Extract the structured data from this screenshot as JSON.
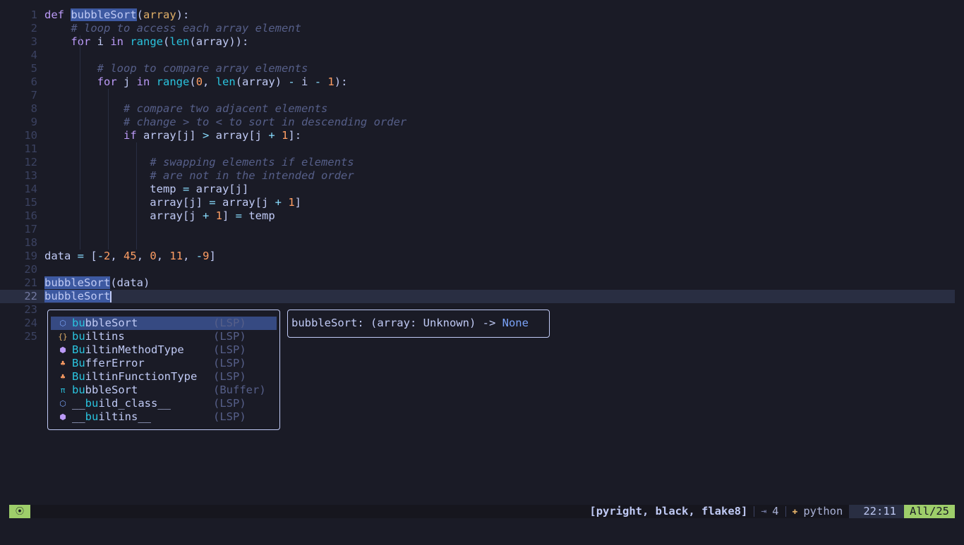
{
  "editor": {
    "lines": [
      {
        "n": "1",
        "tokens": [
          [
            "kw",
            "def "
          ],
          [
            "hl",
            "bubbleSort"
          ],
          [
            "pl",
            "("
          ],
          [
            "pa",
            "array"
          ],
          [
            "pl",
            "):"
          ]
        ]
      },
      {
        "n": "2",
        "tokens": [
          [
            "pl",
            "    "
          ],
          [
            "cm",
            "# loop to access each array element"
          ]
        ]
      },
      {
        "n": "3",
        "tokens": [
          [
            "pl",
            "    "
          ],
          [
            "kw",
            "for"
          ],
          [
            "pl",
            " i "
          ],
          [
            "kw",
            "in"
          ],
          [
            "pl",
            " "
          ],
          [
            "bi",
            "range"
          ],
          [
            "pl",
            "("
          ],
          [
            "bi",
            "len"
          ],
          [
            "pl",
            "(array)):"
          ]
        ]
      },
      {
        "n": "4",
        "tokens": []
      },
      {
        "n": "5",
        "tokens": [
          [
            "pl",
            "        "
          ],
          [
            "cm",
            "# loop to compare array elements"
          ]
        ]
      },
      {
        "n": "6",
        "tokens": [
          [
            "pl",
            "        "
          ],
          [
            "kw",
            "for"
          ],
          [
            "pl",
            " j "
          ],
          [
            "kw",
            "in"
          ],
          [
            "pl",
            " "
          ],
          [
            "bi",
            "range"
          ],
          [
            "pl",
            "("
          ],
          [
            "nm",
            "0"
          ],
          [
            "pl",
            ", "
          ],
          [
            "bi",
            "len"
          ],
          [
            "pl",
            "(array) "
          ],
          [
            "op",
            "-"
          ],
          [
            "pl",
            " i "
          ],
          [
            "op",
            "-"
          ],
          [
            "pl",
            " "
          ],
          [
            "nm",
            "1"
          ],
          [
            "pl",
            "):"
          ]
        ]
      },
      {
        "n": "7",
        "tokens": []
      },
      {
        "n": "8",
        "tokens": [
          [
            "pl",
            "            "
          ],
          [
            "cm",
            "# compare two adjacent elements"
          ]
        ]
      },
      {
        "n": "9",
        "tokens": [
          [
            "pl",
            "            "
          ],
          [
            "cm",
            "# change > to < to sort in descending order"
          ]
        ]
      },
      {
        "n": "10",
        "tokens": [
          [
            "pl",
            "            "
          ],
          [
            "kw",
            "if"
          ],
          [
            "pl",
            " array[j] "
          ],
          [
            "op",
            ">"
          ],
          [
            "pl",
            " array[j "
          ],
          [
            "op",
            "+"
          ],
          [
            "pl",
            " "
          ],
          [
            "nm",
            "1"
          ],
          [
            "pl",
            "]:"
          ]
        ]
      },
      {
        "n": "11",
        "tokens": []
      },
      {
        "n": "12",
        "tokens": [
          [
            "pl",
            "                "
          ],
          [
            "cm",
            "# swapping elements if elements"
          ]
        ]
      },
      {
        "n": "13",
        "tokens": [
          [
            "pl",
            "                "
          ],
          [
            "cm",
            "# are not in the intended order"
          ]
        ]
      },
      {
        "n": "14",
        "tokens": [
          [
            "pl",
            "                temp "
          ],
          [
            "op",
            "="
          ],
          [
            "pl",
            " array[j]"
          ]
        ]
      },
      {
        "n": "15",
        "tokens": [
          [
            "pl",
            "                array[j] "
          ],
          [
            "op",
            "="
          ],
          [
            "pl",
            " array[j "
          ],
          [
            "op",
            "+"
          ],
          [
            "pl",
            " "
          ],
          [
            "nm",
            "1"
          ],
          [
            "pl",
            "]"
          ]
        ]
      },
      {
        "n": "16",
        "tokens": [
          [
            "pl",
            "                array[j "
          ],
          [
            "op",
            "+"
          ],
          [
            "pl",
            " "
          ],
          [
            "nm",
            "1"
          ],
          [
            "pl",
            "] "
          ],
          [
            "op",
            "="
          ],
          [
            "pl",
            " temp"
          ]
        ]
      },
      {
        "n": "17",
        "tokens": []
      },
      {
        "n": "18",
        "tokens": []
      },
      {
        "n": "19",
        "tokens": [
          [
            "pl",
            "data "
          ],
          [
            "op",
            "="
          ],
          [
            "pl",
            " ["
          ],
          [
            "op",
            "-"
          ],
          [
            "nm",
            "2"
          ],
          [
            "pl",
            ", "
          ],
          [
            "nm",
            "45"
          ],
          [
            "pl",
            ", "
          ],
          [
            "nm",
            "0"
          ],
          [
            "pl",
            ", "
          ],
          [
            "nm",
            "11"
          ],
          [
            "pl",
            ", "
          ],
          [
            "op",
            "-"
          ],
          [
            "nm",
            "9"
          ],
          [
            "pl",
            "]"
          ]
        ]
      },
      {
        "n": "20",
        "tokens": []
      },
      {
        "n": "21",
        "tokens": [
          [
            "hl",
            "bubbleSort"
          ],
          [
            "pl",
            "(data)"
          ]
        ]
      },
      {
        "n": "22",
        "tokens": [
          [
            "hl",
            "bubbleSort"
          ]
        ],
        "current": true
      },
      {
        "n": "23",
        "tokens": []
      },
      {
        "n": "24",
        "tokens": []
      },
      {
        "n": "25",
        "tokens": []
      }
    ]
  },
  "completion": {
    "items": [
      {
        "icon": "⬡",
        "icon_name": "method-icon",
        "icon_color": "#7aa2f7",
        "pre": "",
        "match": "bu",
        "rest": "bbleSort",
        "source": "(LSP)",
        "selected": true
      },
      {
        "icon": "{}",
        "icon_name": "module-icon",
        "icon_color": "#e0af68",
        "pre": "",
        "match": "bu",
        "rest": "iltins",
        "source": "(LSP)"
      },
      {
        "icon": "⬢",
        "icon_name": "class-icon",
        "icon_color": "#bb9af7",
        "pre": "",
        "match": "Bu",
        "rest": "iltinMethodType",
        "source": "(LSP)"
      },
      {
        "icon": "♣",
        "icon_name": "struct-icon",
        "icon_color": "#ff9e64",
        "pre": "",
        "match": "Bu",
        "rest": "fferError",
        "source": "(LSP)"
      },
      {
        "icon": "♣",
        "icon_name": "struct-icon",
        "icon_color": "#ff9e64",
        "pre": "",
        "match": "Bu",
        "rest": "iltinFunctionType",
        "source": "(LSP)"
      },
      {
        "icon": "π",
        "icon_name": "text-icon",
        "icon_color": "#2ac3de",
        "pre": "",
        "match": "bu",
        "rest": "bbleSort",
        "source": "(Buffer)"
      },
      {
        "icon": "⬡",
        "icon_name": "method-icon",
        "icon_color": "#7aa2f7",
        "pre": "__",
        "match": "bu",
        "rest": "ild_class__",
        "source": "(LSP)"
      },
      {
        "icon": "⬢",
        "icon_name": "class-icon",
        "icon_color": "#bb9af7",
        "pre": "__",
        "match": "bu",
        "rest": "iltins__",
        "source": "(LSP)"
      }
    ]
  },
  "signature": {
    "prefix": "bubbleSort: (array: Unknown) -> ",
    "return_type": "None"
  },
  "statusbar": {
    "mode_icon": "⦿",
    "lsp_clients": "[pyright, black, flake8]",
    "indent_icon": "⇥",
    "indent_size": "4",
    "lang_icon": "✚",
    "language": "python",
    "position": "22:11",
    "percent": "All/25"
  },
  "colors": {
    "background": "#1a1b26",
    "keyword": "#bb9af7",
    "function": "#7aa2f7",
    "comment": "#565f89",
    "number": "#ff9e64",
    "accent_green": "#9ece6a"
  }
}
